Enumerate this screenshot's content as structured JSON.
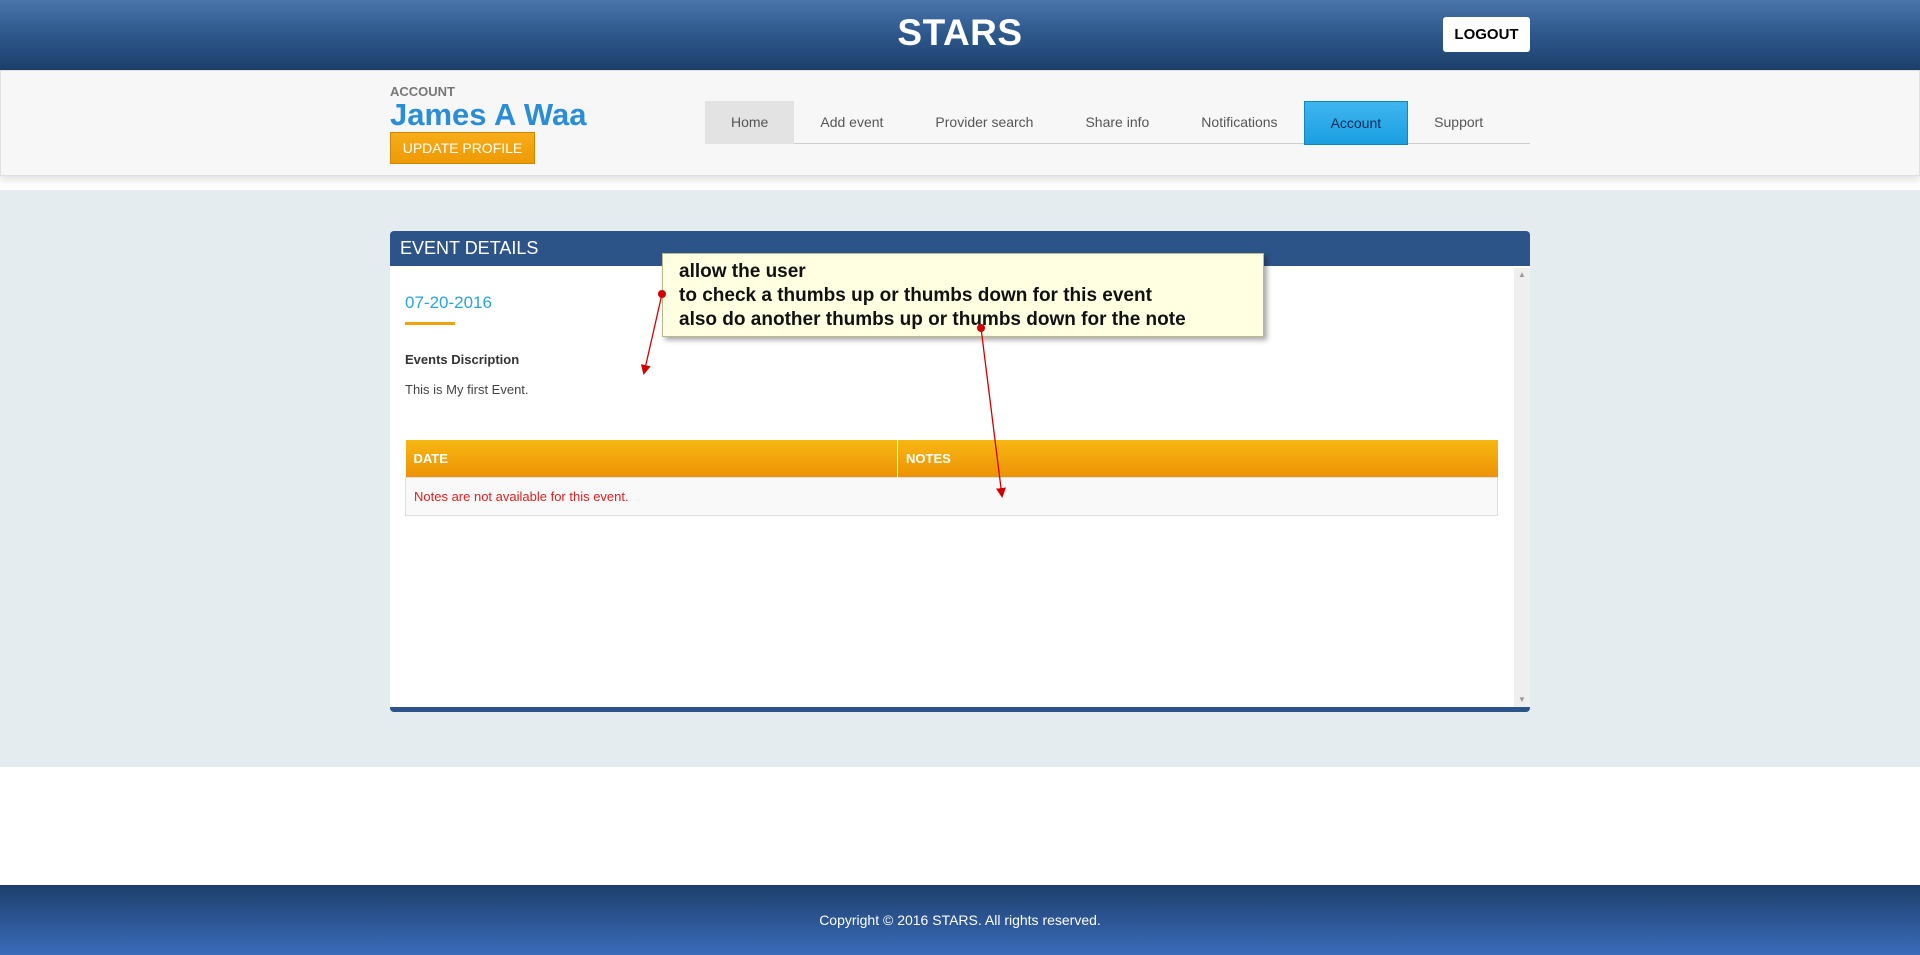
{
  "header": {
    "brand": "STARS",
    "logout_label": "LOGOUT"
  },
  "account": {
    "section_label": "ACCOUNT",
    "user_name": "James A Waa",
    "update_profile_label": "UPDATE PROFILE"
  },
  "nav": {
    "items": [
      {
        "label": "Home"
      },
      {
        "label": "Add event"
      },
      {
        "label": "Provider search"
      },
      {
        "label": "Share info"
      },
      {
        "label": "Notifications"
      },
      {
        "label": "Account",
        "active": true
      },
      {
        "label": "Support"
      }
    ]
  },
  "event_panel": {
    "title": "EVENT DETAILS",
    "date": "07-20-2016",
    "description_label": "Events Discription",
    "description_text": "This is My first Event.",
    "table": {
      "columns": [
        "DATE",
        "NOTES"
      ],
      "empty_message": "Notes are not available for this event."
    }
  },
  "annotation": {
    "lines": [
      "allow the user",
      "to check a thumbs up or thumbs down for this event",
      "also do another thumbs up or thumbs down for the note"
    ]
  },
  "footer": {
    "copyright": "Copyright © 2016 STARS. All rights reserved."
  },
  "colors": {
    "header_blue": "#2f5a8e",
    "accent_orange": "#ee9a05",
    "link_blue": "#2a8ed6",
    "active_tab": "#1a9fe2",
    "error_red": "#e02020"
  }
}
